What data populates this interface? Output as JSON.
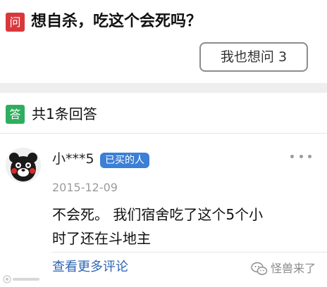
{
  "question": {
    "badge": "问",
    "title": "想自杀，吃这个会死吗？",
    "ask_button": "我也想问 3"
  },
  "answers": {
    "badge": "答",
    "count_label": "共1条回答",
    "items": [
      {
        "username": "小***5",
        "buyer_badge": "已买的人",
        "date": "2015-12-09",
        "text_line1": "不会死。 我们宿舍吃了这个5个小",
        "text_line2": "时了还在斗地主",
        "more_comments": "查看更多评论"
      }
    ]
  },
  "icons": {
    "more": "more-dots-icon",
    "avatar": "kumamon-avatar",
    "wechat": "wechat-icon"
  },
  "watermark": {
    "right_text": "怪兽来了"
  },
  "colors": {
    "question_badge": "#d9383b",
    "answer_badge": "#2fad5e",
    "buyer_badge": "#3b7fd6",
    "link": "#2f66b3"
  }
}
